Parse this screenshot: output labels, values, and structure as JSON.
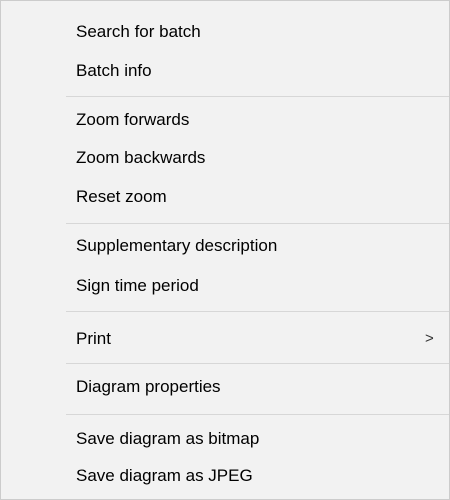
{
  "context_menu": {
    "groups": [
      {
        "items": [
          {
            "label": "Search for batch"
          },
          {
            "label": "Batch info"
          }
        ]
      },
      {
        "items": [
          {
            "label": "Zoom forwards"
          },
          {
            "label": "Zoom backwards"
          },
          {
            "label": "Reset zoom"
          }
        ]
      },
      {
        "items": [
          {
            "label": "Supplementary description"
          },
          {
            "label": "Sign time period"
          }
        ]
      },
      {
        "items": [
          {
            "label": "Print",
            "submenu_indicator": ">"
          }
        ]
      },
      {
        "items": [
          {
            "label": "Diagram properties"
          }
        ]
      },
      {
        "items": [
          {
            "label": "Save diagram as bitmap"
          },
          {
            "label": "Save diagram as JPEG"
          }
        ]
      }
    ]
  },
  "colors": {
    "menu_background": "#f2f2f2",
    "menu_border": "#cccccc",
    "separator": "#d7d7d7",
    "text": "#000000"
  }
}
